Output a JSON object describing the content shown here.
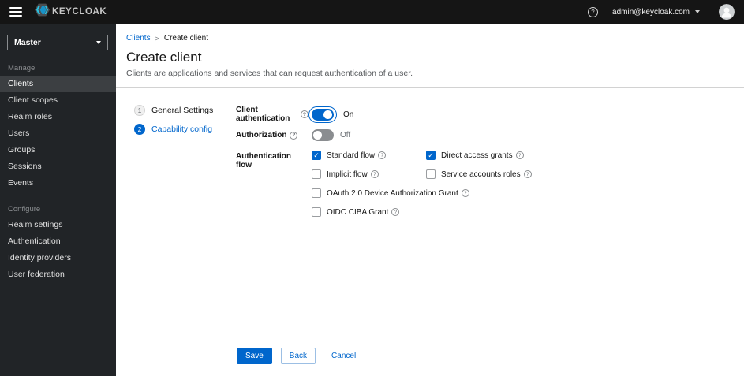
{
  "header": {
    "logo_text": "KEYCLOAK",
    "user_email": "admin@keycloak.com"
  },
  "icons": {
    "help_glyph": "?"
  },
  "sidebar": {
    "realm_selector": {
      "value": "Master"
    },
    "sections": [
      {
        "label": "Manage",
        "items": [
          {
            "label": "Clients",
            "active": true
          },
          {
            "label": "Client scopes",
            "active": false
          },
          {
            "label": "Realm roles",
            "active": false
          },
          {
            "label": "Users",
            "active": false
          },
          {
            "label": "Groups",
            "active": false
          },
          {
            "label": "Sessions",
            "active": false
          },
          {
            "label": "Events",
            "active": false
          }
        ]
      },
      {
        "label": "Configure",
        "items": [
          {
            "label": "Realm settings",
            "active": false
          },
          {
            "label": "Authentication",
            "active": false
          },
          {
            "label": "Identity providers",
            "active": false
          },
          {
            "label": "User federation",
            "active": false
          }
        ]
      }
    ]
  },
  "breadcrumb": {
    "items": [
      "Clients",
      "Create client"
    ],
    "separator": ">"
  },
  "page": {
    "title": "Create client",
    "description": "Clients are applications and services that can request authentication of a user."
  },
  "wizard": {
    "steps": [
      {
        "number": "1",
        "label": "General Settings",
        "active": false
      },
      {
        "number": "2",
        "label": "Capability config",
        "active": true
      }
    ]
  },
  "form": {
    "client_authentication": {
      "label": "Client authentication",
      "state": "On",
      "enabled": true
    },
    "authorization": {
      "label": "Authorization",
      "state": "Off",
      "enabled": false
    },
    "authentication_flow": {
      "label": "Authentication flow",
      "options": [
        {
          "label": "Standard flow",
          "checked": true
        },
        {
          "label": "Direct access grants",
          "checked": true
        },
        {
          "label": "Implicit flow",
          "checked": false
        },
        {
          "label": "Service accounts roles",
          "checked": false
        },
        {
          "label": "OAuth 2.0 Device Authorization Grant",
          "checked": false
        },
        {
          "label": "OIDC CIBA Grant",
          "checked": false
        }
      ]
    }
  },
  "footer": {
    "save": "Save",
    "back": "Back",
    "cancel": "Cancel"
  },
  "colors": {
    "primary": "#0066cc",
    "header_bg": "#151515",
    "sidebar_bg": "#212427",
    "sidebar_active_bg": "#3c3f42",
    "divider": "#d2d2d2"
  }
}
